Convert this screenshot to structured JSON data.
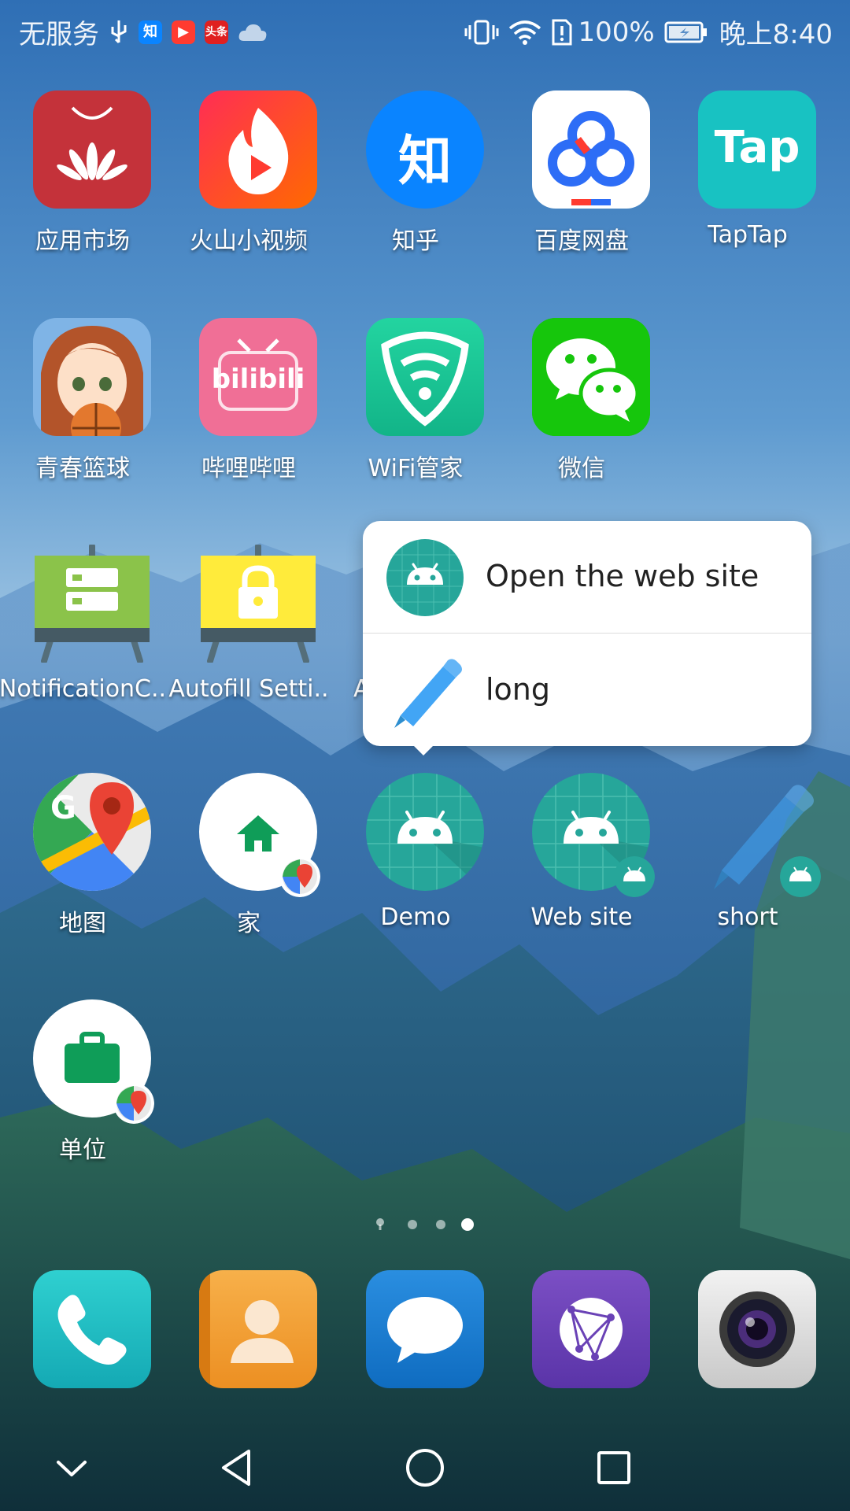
{
  "status_bar": {
    "carrier": "无服务",
    "notif_apps": [
      "知",
      "头条"
    ],
    "battery": "100%",
    "time": "晚上8:40"
  },
  "apps": [
    {
      "id": "app-market",
      "label": "应用市场"
    },
    {
      "id": "huoshan",
      "label": "火山小视频"
    },
    {
      "id": "zhihu",
      "label": "知乎",
      "icon_text": "知"
    },
    {
      "id": "baidu-pan",
      "label": "百度网盘"
    },
    {
      "id": "taptap",
      "label": "TapTap",
      "icon_text": "Tap"
    },
    {
      "id": "qingchun",
      "label": "青春篮球"
    },
    {
      "id": "bilibili",
      "label": "哔哩哔哩",
      "icon_text": "bilibili"
    },
    {
      "id": "wifi-guanjia",
      "label": "WiFi管家"
    },
    {
      "id": "wechat",
      "label": "微信"
    },
    {
      "id": "notification-c",
      "label": "NotificationC.."
    },
    {
      "id": "autofill-settings",
      "label": "Autofill Setti.."
    },
    {
      "id": "a-partial",
      "label": "A"
    },
    {
      "id": "maps",
      "label": "地图"
    },
    {
      "id": "home",
      "label": "家"
    },
    {
      "id": "demo",
      "label": "Demo"
    },
    {
      "id": "web-site",
      "label": "Web site"
    },
    {
      "id": "short",
      "label": "short"
    },
    {
      "id": "work",
      "label": "单位"
    }
  ],
  "popup": {
    "items": [
      {
        "label": "Open the web site",
        "icon": "android-icon"
      },
      {
        "label": "long",
        "icon": "pencil-icon"
      }
    ]
  },
  "page_indicator": {
    "count": 4,
    "current": 4
  },
  "dock": [
    {
      "id": "phone",
      "icon": "phone-icon"
    },
    {
      "id": "contacts",
      "icon": "contacts-icon"
    },
    {
      "id": "messages",
      "icon": "messages-icon"
    },
    {
      "id": "browser",
      "icon": "browser-icon"
    },
    {
      "id": "camera",
      "icon": "camera-icon"
    }
  ],
  "nav": [
    "nav-down-icon",
    "nav-back-icon",
    "nav-home-icon",
    "nav-recents-icon"
  ]
}
